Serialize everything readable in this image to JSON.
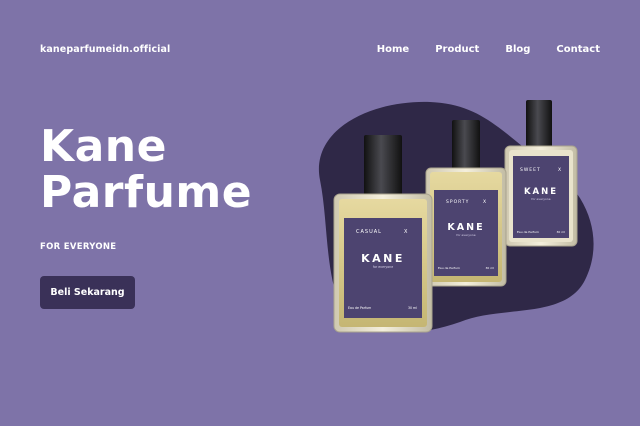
{
  "header": {
    "brand": "kaneparfumeidn.official",
    "nav": [
      {
        "label": "Home"
      },
      {
        "label": "Product"
      },
      {
        "label": "Blog"
      },
      {
        "label": "Contact"
      }
    ]
  },
  "hero": {
    "title_line1": "Kane",
    "title_line2": "Parfume",
    "tagline": "FOR EVERYONE",
    "cta_label": "Beli Sekarang"
  },
  "products": [
    {
      "variant": "CASUAL",
      "mark": "X",
      "brand": "KANE",
      "sub": "for everyone",
      "type": "Eau de Parfum",
      "volume": "30 ml"
    },
    {
      "variant": "SPORTY",
      "mark": "X",
      "brand": "KANE",
      "sub": "for everyone",
      "type": "Eau de Parfum",
      "volume": "30 ml"
    },
    {
      "variant": "SWEET",
      "mark": "X",
      "brand": "KANE",
      "sub": "for everyone",
      "type": "Eau de Parfum",
      "volume": "30 ml"
    }
  ],
  "colors": {
    "background": "#7e73a8",
    "blob": "#2f2847",
    "label": "#4d4470",
    "button": "#3a3158",
    "cap": "#1b1a1f",
    "liquid": "#d7c98a"
  }
}
